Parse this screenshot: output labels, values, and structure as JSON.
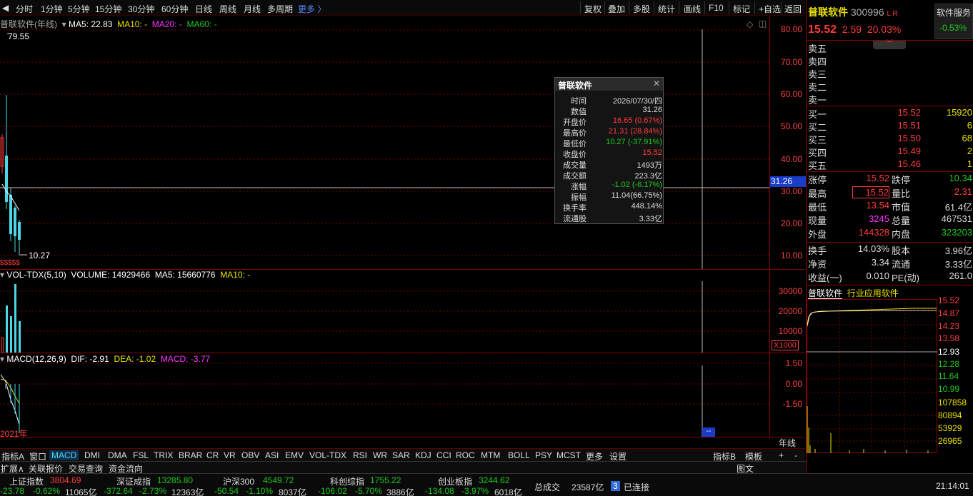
{
  "toolbar": {
    "periods": [
      "分时",
      "1分钟",
      "5分钟",
      "15分钟",
      "30分钟",
      "60分钟",
      "日线",
      "周线",
      "月线",
      "多周期",
      "更多 〉"
    ],
    "actions": [
      "复权",
      "叠加",
      "多股",
      "统计",
      "画线",
      "F10",
      "标记",
      "+自选",
      "返回"
    ]
  },
  "main_chart": {
    "title": "普联软件(年线)",
    "ma5": "MA5: 22.83",
    "ma10": "MA10: -",
    "ma20": "MA20: -",
    "ma60": "MA60: -",
    "high_marker": "79.55",
    "low_marker": "10.27",
    "cross_price": "31.26",
    "y_ticks": [
      "80.00",
      "70.00",
      "60.00",
      "50.00",
      "40.00",
      "30.00",
      "20.00",
      "10.00"
    ],
    "small_marks": "$$$$$"
  },
  "volume_chart": {
    "title": "VOL-TDX(5,10)",
    "volume": "VOLUME: 14929466",
    "ma5": "MA5: 15660776",
    "ma10": "MA10: -",
    "y_ticks": [
      "30000",
      "20000",
      "10000"
    ],
    "unit": "X1000"
  },
  "macd_chart": {
    "title": "MACD(12,26,9)",
    "dif": "DIF: -2.91",
    "dea": "DEA: -1.02",
    "macd": "MACD: -3.77",
    "y_ticks": [
      "1.50",
      "0.00",
      "-1.50"
    ],
    "year_label": "2021年",
    "period_label": "年线",
    "cursor_label": "--"
  },
  "popup": {
    "title": "普联软件",
    "close": "✕",
    "rows": [
      {
        "k": "时间",
        "v": "2026/07/30/四",
        "c": "#ddd"
      },
      {
        "k": "数值",
        "v": "31.26",
        "c": "#ddd"
      },
      {
        "k": "开盘价",
        "v": "16.65 (0.67%)",
        "c": "#ff3b3b"
      },
      {
        "k": "最高价",
        "v": "21.31 (28.84%)",
        "c": "#ff3b3b"
      },
      {
        "k": "最低价",
        "v": "10.27 (-37.91%)",
        "c": "#1ec81e"
      },
      {
        "k": "收盘价",
        "v": "15.52",
        "c": "#ff3b3b"
      },
      {
        "k": "成交量",
        "v": "1493万",
        "c": "#ddd"
      },
      {
        "k": "成交额",
        "v": "223.3亿",
        "c": "#ddd"
      },
      {
        "k": "涨幅",
        "v": "-1.02 (-6.17%)",
        "c": "#1ec81e"
      },
      {
        "k": "振幅",
        "v": "11.04(66.75%)",
        "c": "#ddd"
      },
      {
        "k": "换手率",
        "v": "448.14%",
        "c": "#ddd"
      },
      {
        "k": "流通股",
        "v": "3.33亿",
        "c": "#ddd"
      }
    ]
  },
  "quote": {
    "name": "普联软件",
    "code": "300996",
    "tags": "L R",
    "price": "15.52",
    "change": "2.59",
    "pct": "20.03%",
    "service": "软件服务",
    "service_pct": "-0.53%",
    "sell": [
      {
        "l": "卖五",
        "p": "",
        "q": ""
      },
      {
        "l": "卖四",
        "p": "",
        "q": ""
      },
      {
        "l": "卖三",
        "p": "",
        "q": ""
      },
      {
        "l": "卖二",
        "p": "",
        "q": ""
      },
      {
        "l": "卖一",
        "p": "",
        "q": ""
      }
    ],
    "buy": [
      {
        "l": "买一",
        "p": "15.52",
        "q": "15920"
      },
      {
        "l": "买二",
        "p": "15.51",
        "q": "6"
      },
      {
        "l": "买三",
        "p": "15.50",
        "q": "68"
      },
      {
        "l": "买四",
        "p": "15.49",
        "q": "2"
      },
      {
        "l": "买五",
        "p": "15.46",
        "q": "1"
      }
    ],
    "stats1": [
      {
        "a": "涨停",
        "av": "15.52",
        "ac": "#ff3b3b",
        "b": "跌停",
        "bv": "10.34",
        "bc": "#1ec81e"
      },
      {
        "a": "最高",
        "av": "15.52",
        "ac": "#ff3b3b",
        "b": "量比",
        "bv": "2.31",
        "bc": "#ff3b3b"
      },
      {
        "a": "最低",
        "av": "13.54",
        "ac": "#ff3b3b",
        "b": "市值",
        "bv": "61.4亿",
        "bc": "#ddd"
      },
      {
        "a": "现量",
        "av": "3245",
        "ac": "#ff33ff",
        "b": "总量",
        "bv": "467531",
        "bc": "#ddd"
      },
      {
        "a": "外盘",
        "av": "144328",
        "ac": "#ff3b3b",
        "b": "内盘",
        "bv": "323203",
        "bc": "#1ec81e"
      }
    ],
    "stats2": [
      {
        "a": "换手",
        "av": "14.03%",
        "b": "股本",
        "bv": "3.96亿"
      },
      {
        "a": "净资",
        "av": "3.34",
        "b": "流通",
        "bv": "3.33亿"
      },
      {
        "a": "收益(一)",
        "av": "0.010",
        "b": "PE(动)",
        "bv": "261.0"
      }
    ],
    "mini_tab1": "普联软件",
    "mini_tab2": "行业应用软件",
    "mini_y": [
      {
        "v": "15.52",
        "c": "#ff3b3b"
      },
      {
        "v": "14.87",
        "c": "#ff3b3b"
      },
      {
        "v": "14.23",
        "c": "#ff3b3b"
      },
      {
        "v": "13.58",
        "c": "#ff3b3b"
      },
      {
        "v": "12.93",
        "c": "#ffffff"
      },
      {
        "v": "12.28",
        "c": "#1ec81e"
      },
      {
        "v": "11.64",
        "c": "#1ec81e"
      },
      {
        "v": "10.99",
        "c": "#1ec81e"
      },
      {
        "v": "107858",
        "c": "#e8e000"
      },
      {
        "v": "80894",
        "c": "#e8e000"
      },
      {
        "v": "53929",
        "c": "#e8e000"
      },
      {
        "v": "26965",
        "c": "#e8e000"
      }
    ]
  },
  "indicator_tabs": [
    "指标A",
    "窗口",
    "MACD",
    "DMI",
    "DMA",
    "FSL",
    "TRIX",
    "BRAR",
    "CR",
    "VR",
    "OBV",
    "ASI",
    "EMV",
    "VOL-TDX",
    "RSI",
    "WR",
    "SAR",
    "KDJ",
    "CCI",
    "ROC",
    "MTM",
    "BOLL",
    "PSY",
    "MCST",
    "更多",
    "设置"
  ],
  "indicator_right": [
    "指标B",
    "模板",
    "+",
    "-"
  ],
  "bottom_tabs": [
    "扩展∧",
    "关联报价",
    "交易查询",
    "资金流向"
  ],
  "bottom_right": "图文",
  "status": {
    "indices": [
      {
        "name": "上证指数",
        "val": "3804.69",
        "chg": "-23.78",
        "pct": "-0.62%",
        "amt": "11065亿"
      },
      {
        "name": "深证成指",
        "val": "13285.80",
        "chg": "-372.64",
        "pct": "-2.73%",
        "amt": "12363亿"
      },
      {
        "name": "沪深300",
        "val": "4549.72",
        "chg": "-50.54",
        "pct": "-1.10%",
        "amt": "8037亿"
      },
      {
        "name": "科创综指",
        "val": "1755.22",
        "chg": "-106.02",
        "pct": "-5.70%",
        "amt": "3886亿"
      },
      {
        "name": "创业板指",
        "val": "3244.62",
        "chg": "-134.08",
        "pct": "-3.97%",
        "amt": "6018亿"
      }
    ],
    "total_label": "总成交",
    "total_value": "23587亿",
    "conn_count": "3",
    "conn_text": "已连接",
    "time": "21:14:01"
  }
}
